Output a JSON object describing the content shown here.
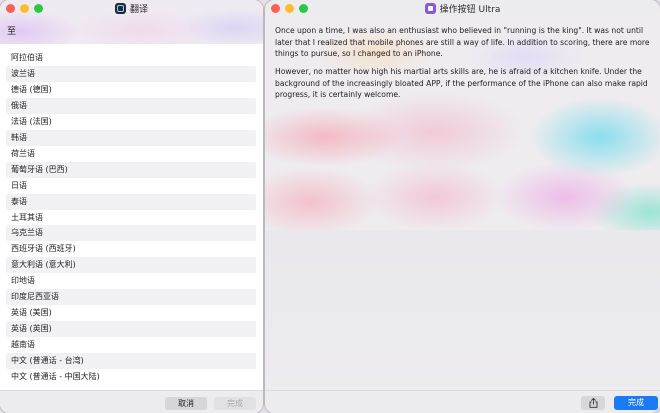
{
  "left_window": {
    "title": "翻译",
    "to_label": "至",
    "languages": [
      "阿拉伯语",
      "波兰语",
      "德语 (德国)",
      "俄语",
      "法语 (法国)",
      "韩语",
      "荷兰语",
      "葡萄牙语 (巴西)",
      "日语",
      "泰语",
      "土耳其语",
      "乌克兰语",
      "西班牙语 (西班牙)",
      "意大利语 (意大利)",
      "印地语",
      "印度尼西亚语",
      "英语 (美国)",
      "英语 (英国)",
      "越南语",
      "中文 (普通话 - 台湾)",
      "中文 (普通话 - 中国大陆)"
    ],
    "cancel_label": "取消",
    "done_label": "完成"
  },
  "right_window": {
    "title": "操作按钮 Ultra",
    "paragraphs": [
      "Once upon a time, I was also an enthusiast who believed in \"running is the king\". It was not until later that I realized that mobile phones are still a way of life. In addition to scoring, there are more things to pursue, so I changed to an iPhone.",
      "However, no matter how high his martial arts skills are, he is afraid of a kitchen knife. Under the background of the increasingly bloated APP, if the performance of the iPhone can also make rapid progress, it is certainly welcome."
    ],
    "done_label": "完成"
  },
  "icons": {
    "share": "share-icon",
    "left_app": "translate-app-icon",
    "right_app": "shortcuts-app-icon"
  },
  "colors": {
    "accent": "#1a7bf4",
    "close": "#fe5f57",
    "minimize": "#febc2e",
    "zoom": "#28c840"
  }
}
